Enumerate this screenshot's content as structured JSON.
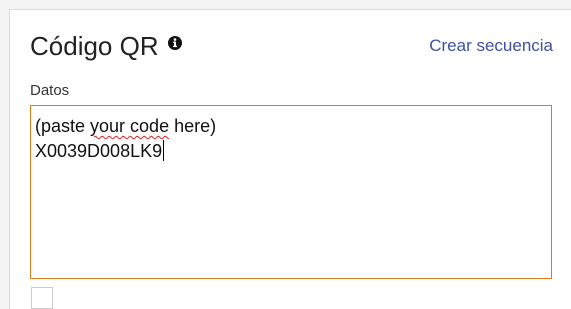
{
  "header": {
    "title": "Código QR",
    "link_label": "Crear secuencia"
  },
  "form": {
    "data_label": "Datos",
    "textarea": {
      "line1_prefix": "(paste ",
      "line1_misspelled": "your code",
      "line1_suffix": " here)",
      "line2": "X0039D008LK9"
    }
  },
  "colors": {
    "accent": "#e07b1a",
    "link": "#3e4fa5",
    "spellcheck": "#e02020"
  },
  "icons": {
    "title_icon": "info-icon"
  }
}
